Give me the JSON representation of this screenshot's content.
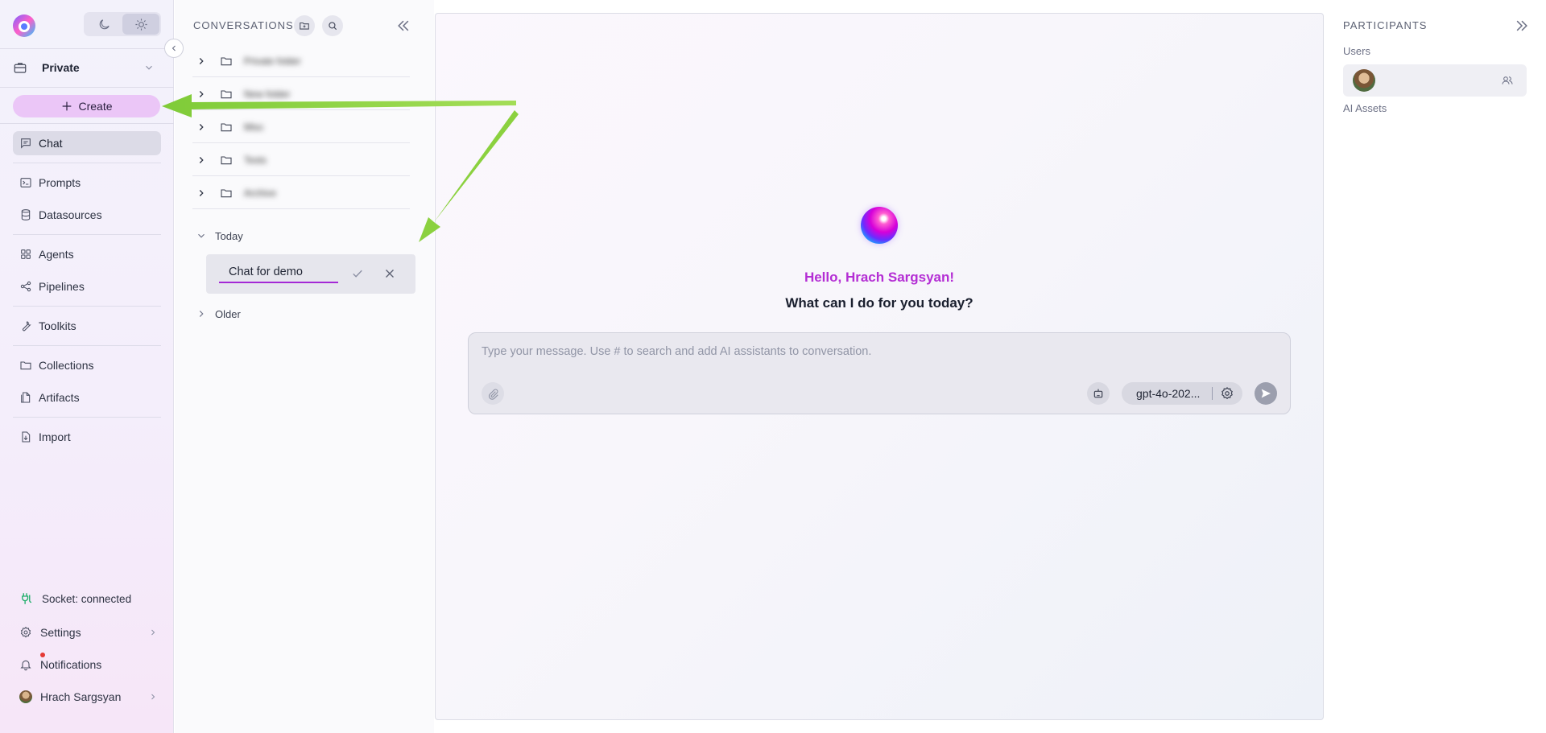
{
  "sidebar": {
    "project": "Private",
    "create_label": "Create",
    "nav": [
      {
        "label": "Chat",
        "icon": "chat-icon"
      },
      {
        "label": "Prompts",
        "icon": "terminal-icon"
      },
      {
        "label": "Datasources",
        "icon": "database-icon"
      },
      {
        "label": "Agents",
        "icon": "grid-icon"
      },
      {
        "label": "Pipelines",
        "icon": "pipeline-icon"
      },
      {
        "label": "Toolkits",
        "icon": "wrench-icon"
      },
      {
        "label": "Collections",
        "icon": "folder-icon"
      },
      {
        "label": "Artifacts",
        "icon": "artifact-icon"
      },
      {
        "label": "Import",
        "icon": "import-icon"
      }
    ],
    "socket_status": "Socket: connected",
    "settings_label": "Settings",
    "notifications_label": "Notifications",
    "user_name": "Hrach Sargsyan"
  },
  "conversations": {
    "title": "CONVERSATIONS",
    "folders": [
      "Private folder",
      "New folder",
      "Misc",
      "Tests",
      "Archive"
    ],
    "today_label": "Today",
    "rename_value": "Chat for demo",
    "older_label": "Older"
  },
  "main": {
    "greeting": "Hello, Hrach Sargsyan!",
    "subgreeting": "What can I do for you today?",
    "placeholder": "Type your message. Use # to search and add AI assistants to conversation.",
    "model": "gpt-4o-202..."
  },
  "participants": {
    "title": "PARTICIPANTS",
    "users_label": "Users",
    "ai_assets_label": "AI Assets"
  },
  "colors": {
    "accent": "#b42ed4",
    "create_button": "#ebc6f7",
    "arrow": "#8bd13f",
    "socket": "#1fae6a"
  }
}
